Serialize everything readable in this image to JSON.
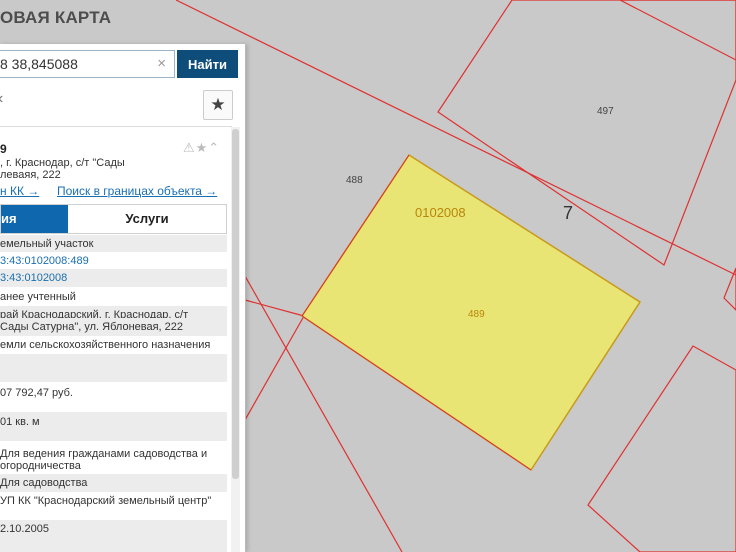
{
  "header": {
    "title": "ОВАЯ КАРТА"
  },
  "search": {
    "value": "8 38,845088",
    "clear_glyph": "×",
    "button_label": "Найти"
  },
  "toolbar": {
    "back_glyph": "‹",
    "favorite_glyph": "★"
  },
  "object": {
    "number": "9",
    "address_lines": [
      ", г. Краснодар, с/т \"Сады",
      "леваяя, 222"
    ],
    "icons": "⚠★⌃",
    "links": [
      "н КК →",
      "Поиск в границах объекта →"
    ]
  },
  "tabs": {
    "active": "ия",
    "other": "Услуги"
  },
  "details": [
    {
      "text": "емельный участок"
    },
    {
      "text": "3:43:0102008:489"
    },
    {
      "text": "3:43:0102008"
    },
    {
      "text": "анее учтенный"
    },
    {
      "text": "рай Краснодарский, г. Краснодар, с/т"
    },
    {
      "text": "Сады Сатурна\", ул. Яблоневая, 222"
    },
    {
      "text": "емли сельскохозяйственного назначения"
    },
    {
      "text": ""
    },
    {
      "text": "07 792,47 руб."
    },
    {
      "text": ""
    },
    {
      "text": "01 кв. м"
    },
    {
      "text": ""
    },
    {
      "text": "Для ведения гражданами садоводства и"
    },
    {
      "text": "огородничества"
    },
    {
      "text": "Для садоводства"
    },
    {
      "text": "УП КК \"Краснодарский земельный центр\""
    },
    {
      "text": ""
    },
    {
      "text": "2.10.2005"
    }
  ],
  "map": {
    "labels": {
      "block": "0102008",
      "quarter": "7",
      "parcel_488": "488",
      "parcel_489": "489",
      "parcel_497": "497"
    },
    "colors": {
      "background": "#c9c9c9",
      "parcel_border": "#e03030",
      "selected_fill": "#e8e574",
      "selected_border": "#c89a1a",
      "label_gold": "#b8860b"
    }
  }
}
